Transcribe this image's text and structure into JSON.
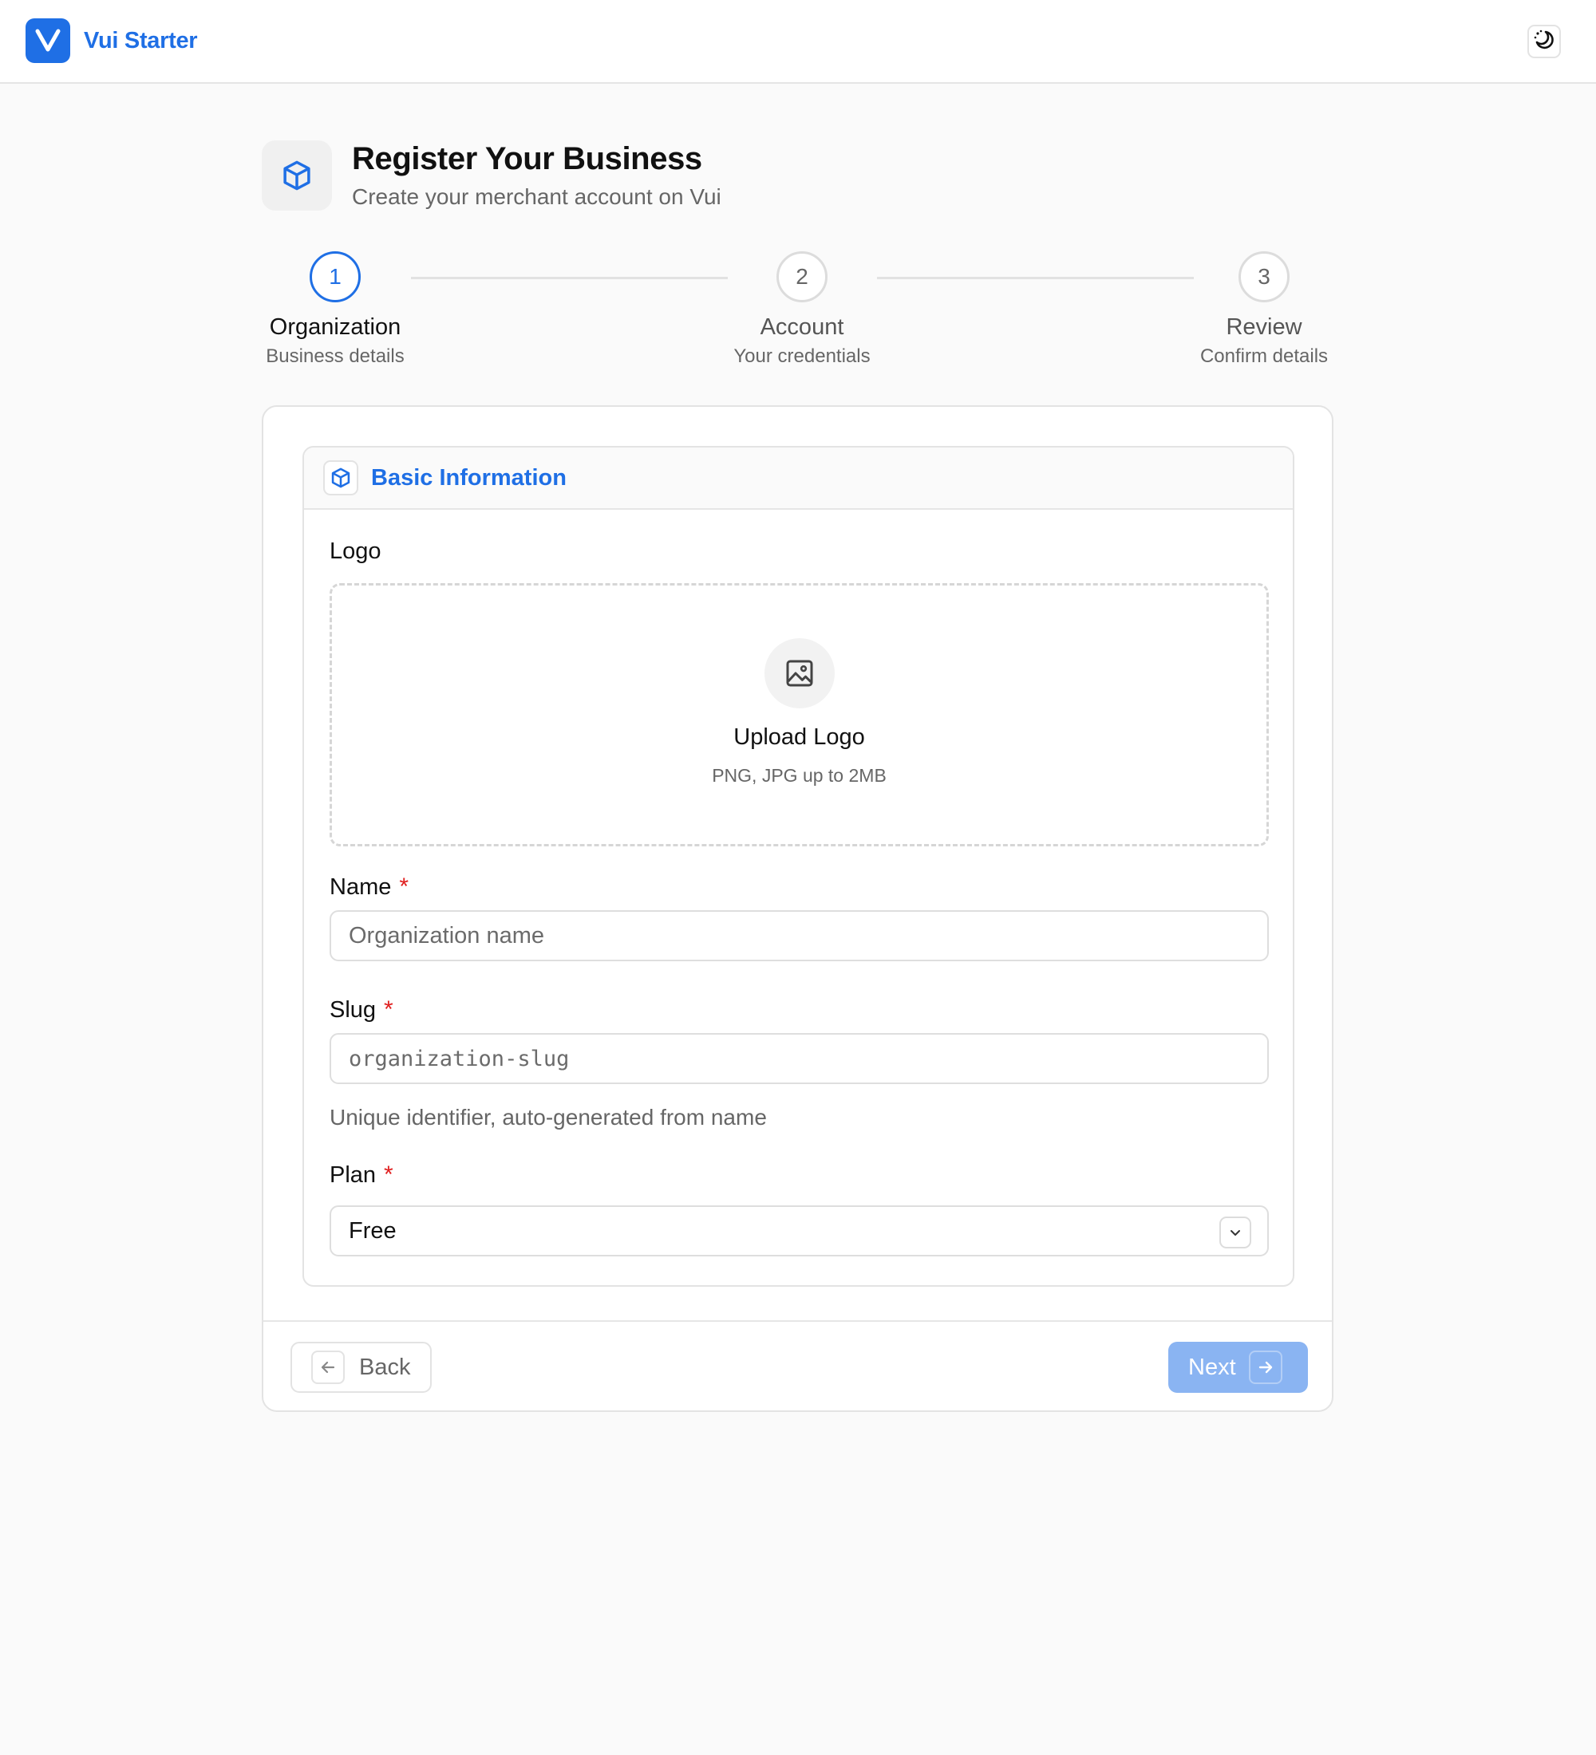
{
  "app": {
    "brand_name": "Vui Starter",
    "icons": {
      "brand": "v-logo-icon",
      "theme_toggle": "moon-icon"
    }
  },
  "header": {
    "title": "Register Your Business",
    "subtitle": "Create your merchant account on Vui",
    "icon": "box-icon"
  },
  "steps": [
    {
      "number": "1",
      "title": "Organization",
      "subtitle": "Business details",
      "active": true
    },
    {
      "number": "2",
      "title": "Account",
      "subtitle": "Your credentials",
      "active": false
    },
    {
      "number": "3",
      "title": "Review",
      "subtitle": "Confirm details",
      "active": false
    }
  ],
  "section": {
    "title": "Basic Information",
    "icon": "box-icon"
  },
  "form": {
    "logo": {
      "label": "Logo",
      "upload_title": "Upload Logo",
      "upload_hint": "PNG, JPG up to 2MB",
      "icon": "image-icon"
    },
    "name": {
      "label": "Name",
      "required_mark": "*",
      "placeholder": "Organization name",
      "value": ""
    },
    "slug": {
      "label": "Slug",
      "required_mark": "*",
      "placeholder": "organization-slug",
      "value": "",
      "help": "Unique identifier, auto-generated from name"
    },
    "plan": {
      "label": "Plan",
      "required_mark": "*",
      "selected": "Free"
    }
  },
  "actions": {
    "back_label": "Back",
    "next_label": "Next"
  },
  "colors": {
    "accent": "#1f6fe5",
    "required": "#e02020",
    "next_disabled": "#8ab4f2",
    "background": "#fafafa"
  }
}
